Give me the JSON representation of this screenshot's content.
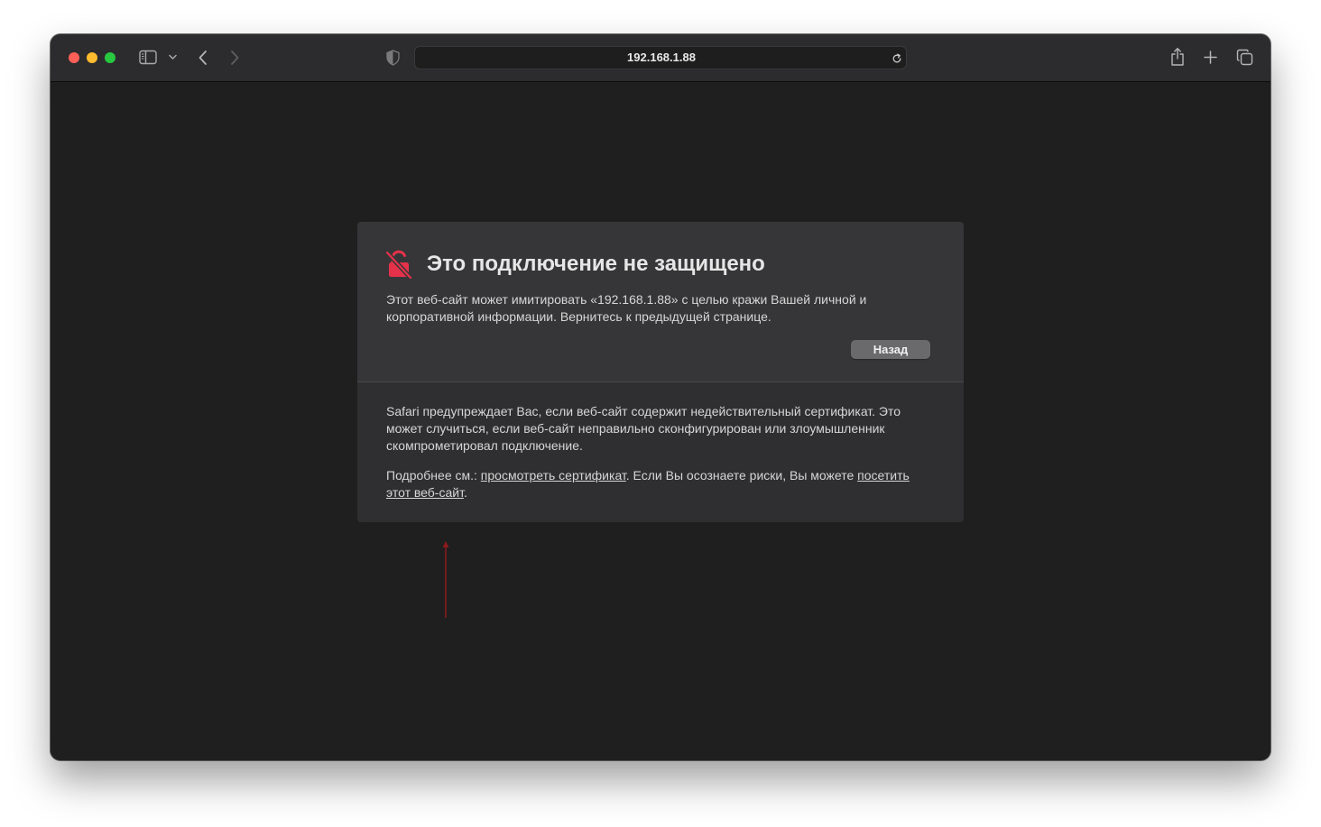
{
  "toolbar": {
    "address": "192.168.1.88",
    "icons": {
      "sidebar": "sidebar-icon",
      "sidebar_menu": "chevron-down-icon",
      "back": "chevron-left-icon",
      "forward": "chevron-right-icon",
      "privacy": "shield-icon",
      "reload": "reload-icon",
      "share": "share-icon",
      "new_tab": "plus-icon",
      "tab_overview": "tabs-icon"
    }
  },
  "warning": {
    "icon": "broken-lock-icon",
    "title": "Это подключение не защищено",
    "description": "Этот веб-сайт может имитировать «192.168.1.88» с целью кражи Вашей личной и корпоративной информации. Вернитесь к предыдущей странице.",
    "back_button": "Назад",
    "details": "Safari предупреждает Вас, если веб-сайт содержит недействительный сертификат. Это может случиться, если веб-сайт неправильно сконфигурирован или злоумышленник скомпрометировал подключение.",
    "more_prefix": "Подробнее см.: ",
    "view_certificate_link": "просмотреть сертификат",
    "more_middle": ". Если Вы осознаете риски, Вы можете ",
    "visit_link": "посетить этот веб-сайт",
    "more_suffix": "."
  },
  "colors": {
    "accent_red": "#e5324a",
    "annotation_arrow": "#8b1a1a",
    "page_background": "#1f1f1f",
    "panel_background": "#363638"
  }
}
